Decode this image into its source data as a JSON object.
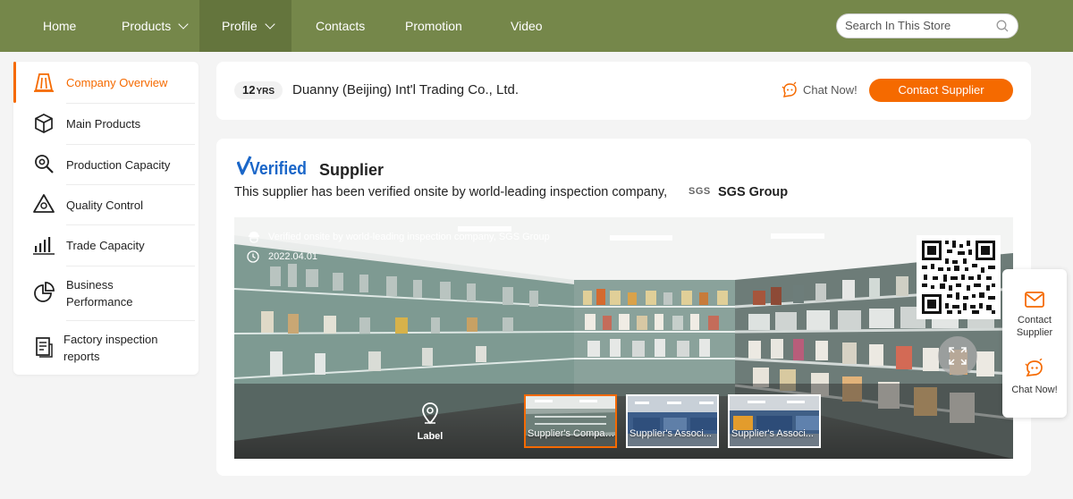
{
  "nav": {
    "items": [
      {
        "label": "Home",
        "dropdown": false,
        "active": false
      },
      {
        "label": "Products",
        "dropdown": true,
        "active": false
      },
      {
        "label": "Profile",
        "dropdown": true,
        "active": true
      },
      {
        "label": "Contacts",
        "dropdown": false,
        "active": false
      },
      {
        "label": "Promotion",
        "dropdown": false,
        "active": false
      },
      {
        "label": "Video",
        "dropdown": false,
        "active": false
      }
    ],
    "search_placeholder": "Search In This Store",
    "bg_color": "#75874a"
  },
  "sidebar": {
    "items": [
      {
        "label": "Company Overview",
        "icon": "company-overview-icon",
        "active": true
      },
      {
        "label": "Main Products",
        "icon": "cube-icon",
        "active": false
      },
      {
        "label": "Production Capacity",
        "icon": "magnifier-gear-icon",
        "active": false
      },
      {
        "label": "Quality Control",
        "icon": "warning-triangle-icon",
        "active": false
      },
      {
        "label": "Trade Capacity",
        "icon": "bar-chart-icon",
        "active": false
      },
      {
        "label": "Business Performance",
        "icon": "pie-chart-icon",
        "active": false
      },
      {
        "label": "Factory inspection reports",
        "icon": "report-document-icon",
        "active": false
      }
    ]
  },
  "header": {
    "years": "12",
    "years_unit": "YRS",
    "company_name": "Duanny (Beijing) Int'l Trading Co., Ltd.",
    "chat_label": "Chat Now!",
    "contact_label": "Contact Supplier"
  },
  "verified": {
    "logo_text": "Verified",
    "title": "Supplier",
    "description": "This supplier has been verified onsite by world-leading inspection company,",
    "inspector_logo": "SGS",
    "inspector_name": "SGS Group"
  },
  "photo": {
    "inspection_note": "Verified onsite by world-leading inspection company, SGS Group",
    "date": "2022.04.01",
    "label_button": "Label",
    "thumbnails": [
      {
        "label": "Supplier's Company...",
        "active": true
      },
      {
        "label": "Supplier's Associ...",
        "active": false
      },
      {
        "label": "Supplier's Associ...",
        "active": false
      }
    ]
  },
  "float_panel": {
    "contact_label": "Contact Supplier",
    "chat_label": "Chat Now!"
  },
  "colors": {
    "accent": "#f56a00",
    "nav_bg": "#75874a",
    "verified_blue": "#1a66c8"
  }
}
